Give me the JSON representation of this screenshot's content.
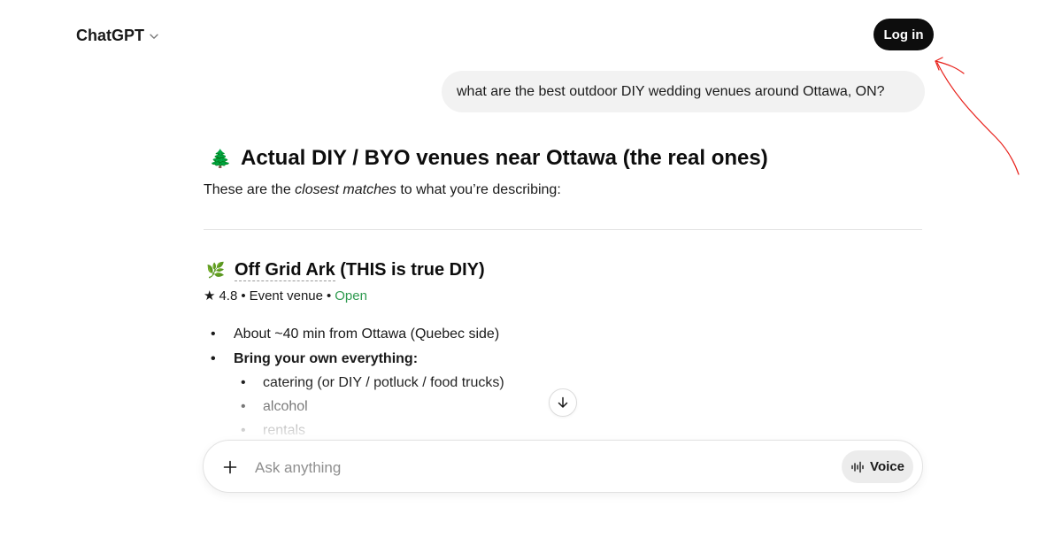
{
  "header": {
    "brand": "ChatGPT",
    "brand_icon": "chevron-down-icon",
    "login_label": "Log in",
    "login_bg": "#0d0d0d"
  },
  "conversation": {
    "user_message": "what are the best outdoor DIY wedding venues around Ottawa, ON?",
    "answer": {
      "heading_emoji": "🌲",
      "heading": "Actual DIY / BYO venues near Ottawa (the real ones)",
      "intro_before": "These are the ",
      "intro_emphasis": "closest matches",
      "intro_after": " to what you’re describing:",
      "venue": {
        "emoji": "🌿",
        "name": "Off Grid Ark",
        "name_suffix": " (THIS is true DIY)",
        "rating_star": "★",
        "rating": "4.8",
        "sep1": " • ",
        "type": "Event venue",
        "sep2": " • ",
        "status": "Open",
        "status_color": "#2e9a4f"
      },
      "bullets": [
        "About ~40 min from Ottawa (Quebec side)",
        "Bring your own everything:"
      ],
      "sub_bullets": [
        "catering (or DIY / potluck / food trucks)",
        "alcohol",
        "rentals"
      ]
    }
  },
  "composer": {
    "add_icon": "plus-icon",
    "placeholder": "Ask anything",
    "value": "",
    "voice_icon": "voice-waveform-icon",
    "voice_label": "Voice"
  },
  "scroll_button_icon": "arrow-down-icon"
}
